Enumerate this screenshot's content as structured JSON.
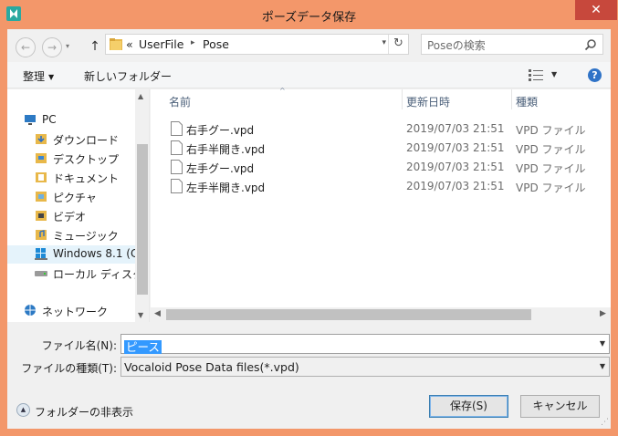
{
  "window": {
    "title": "ポーズデータ保存",
    "close_label": "✕",
    "colors": {
      "frame": "#f3976a",
      "close": "#c7483c",
      "selection": "#3399ff"
    }
  },
  "address_bar": {
    "back_icon": "back-arrow-icon",
    "forward_icon": "forward-arrow-icon",
    "up_label": "↑",
    "prefix": "«",
    "path": [
      "UserFile",
      "Pose"
    ],
    "refresh_label": "↻"
  },
  "search": {
    "placeholder": "Poseの検索"
  },
  "toolbar": {
    "organize_label": "整理",
    "new_folder_label": "新しいフォルダー"
  },
  "nav": {
    "items": [
      {
        "label": "PC",
        "icon": "pc-icon"
      },
      {
        "label": "ダウンロード",
        "icon": "downloads-folder-icon"
      },
      {
        "label": "デスクトップ",
        "icon": "desktop-folder-icon"
      },
      {
        "label": "ドキュメント",
        "icon": "documents-folder-icon"
      },
      {
        "label": "ピクチャ",
        "icon": "pictures-folder-icon"
      },
      {
        "label": "ビデオ",
        "icon": "videos-folder-icon"
      },
      {
        "label": "ミュージック",
        "icon": "music-folder-icon"
      },
      {
        "label": "Windows 8.1 (C",
        "icon": "windows-drive-icon"
      },
      {
        "label": "ローカル ディスク (D",
        "icon": "disk-drive-icon"
      },
      {
        "label": "ネットワーク",
        "icon": "network-icon"
      }
    ]
  },
  "files": {
    "columns": {
      "name": "名前",
      "date": "更新日時",
      "type": "種類"
    },
    "rows": [
      {
        "name": "右手グー.vpd",
        "date": "2019/07/03 21:51",
        "type": "VPD ファイル"
      },
      {
        "name": "右手半開き.vpd",
        "date": "2019/07/03 21:51",
        "type": "VPD ファイル"
      },
      {
        "name": "左手グー.vpd",
        "date": "2019/07/03 21:51",
        "type": "VPD ファイル"
      },
      {
        "name": "左手半開き.vpd",
        "date": "2019/07/03 21:51",
        "type": "VPD ファイル"
      }
    ]
  },
  "form": {
    "filename_label": "ファイル名(N):",
    "filename_value": "ピース",
    "filetype_label": "ファイルの種類(T):",
    "filetype_value": "Vocaloid Pose Data files(*.vpd)"
  },
  "footer": {
    "hide_folders_label": "フォルダーの非表示",
    "save_label": "保存(S)",
    "cancel_label": "キャンセル"
  }
}
